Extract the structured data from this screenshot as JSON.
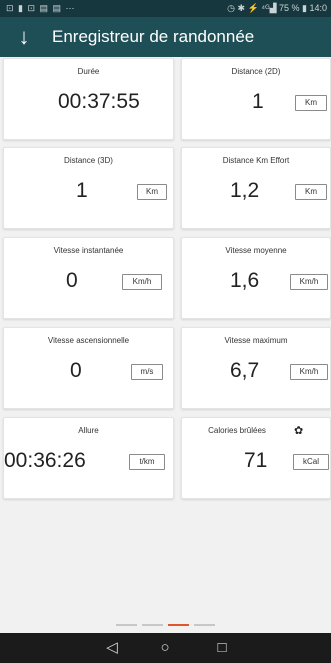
{
  "status_bar": {
    "left_icons": "⊡ ▮ ⊡ ▤ ▤ ⋯",
    "right_text": "◷ ✱ ⚡ ⁴ᴳ▟ 75 % ▮ 14:0"
  },
  "app_bar": {
    "back_icon": "↓",
    "title": "Enregistreur de randonnée"
  },
  "cards": [
    {
      "label": "Durée",
      "value": "00:37:55",
      "unit": ""
    },
    {
      "label": "Distance (2D)",
      "value": "1",
      "unit": "Km"
    },
    {
      "label": "Distance (3D)",
      "value": "1",
      "unit": "Km"
    },
    {
      "label": "Distance Km Effort",
      "value": "1,2",
      "unit": "Km"
    },
    {
      "label": "Vitesse instantanée",
      "value": "0",
      "unit": "Km/h"
    },
    {
      "label": "Vitesse moyenne",
      "value": "1,6",
      "unit": "Km/h"
    },
    {
      "label": "Vitesse ascensionnelle",
      "value": "0",
      "unit": "m/s"
    },
    {
      "label": "Vitesse maximum",
      "value": "6,7",
      "unit": "Km/h"
    },
    {
      "label": "Allure",
      "value": "00:36:26",
      "unit": "t/km"
    },
    {
      "label": "Calories brûlées",
      "value": "71",
      "unit": "kCal",
      "icon": "gear-icon"
    }
  ],
  "icons": {
    "settings": "✿"
  },
  "pager": {
    "active_index": 2,
    "count": 4
  },
  "nav_bar": {
    "back": "◁",
    "home": "○",
    "recents": "□"
  },
  "colors": {
    "app_bar": "#1f4f56",
    "status_bar": "#17373f",
    "pager_active": "#e3552a",
    "nav_bar": "#1b1b1b"
  }
}
